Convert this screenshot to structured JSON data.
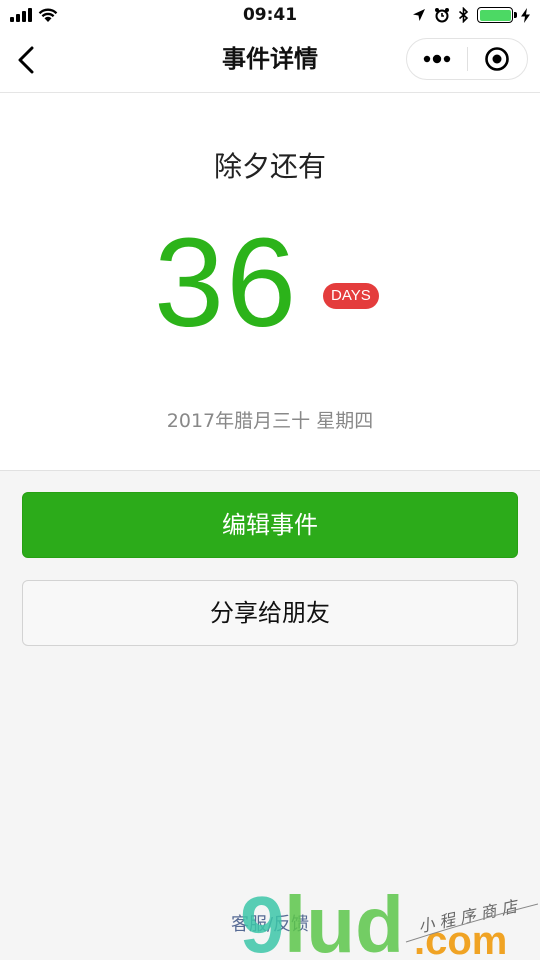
{
  "status_bar": {
    "time": "09:41",
    "signal_icon": "signal-icon",
    "wifi_icon": "wifi-icon",
    "location_icon": "location-arrow-icon",
    "alarm_icon": "alarm-clock-icon",
    "bluetooth_icon": "bluetooth-icon",
    "battery_icon": "battery-icon",
    "charging_icon": "charging-bolt-icon",
    "battery_level": 1.0
  },
  "nav": {
    "title": "事件详情",
    "back_icon": "chevron-left-icon",
    "more_icon": "more-dots-icon",
    "close_icon": "target-circle-icon"
  },
  "event": {
    "label": "除夕还有",
    "count": "36",
    "unit": "DAYS",
    "date": "2017年腊月三十 星期四"
  },
  "actions": {
    "edit_label": "编辑事件",
    "share_label": "分享给朋友"
  },
  "footer": {
    "feedback_label": "客服/反馈"
  },
  "watermark": {
    "logo_text": "9lud",
    "domain_text": ".com",
    "tagline": "小程序商店"
  },
  "colors": {
    "accent_green": "#2cb31a",
    "button_green": "#2cab1a",
    "badge_red": "#e43c3c",
    "link_blue": "#576b95",
    "muted_text": "#888888"
  }
}
